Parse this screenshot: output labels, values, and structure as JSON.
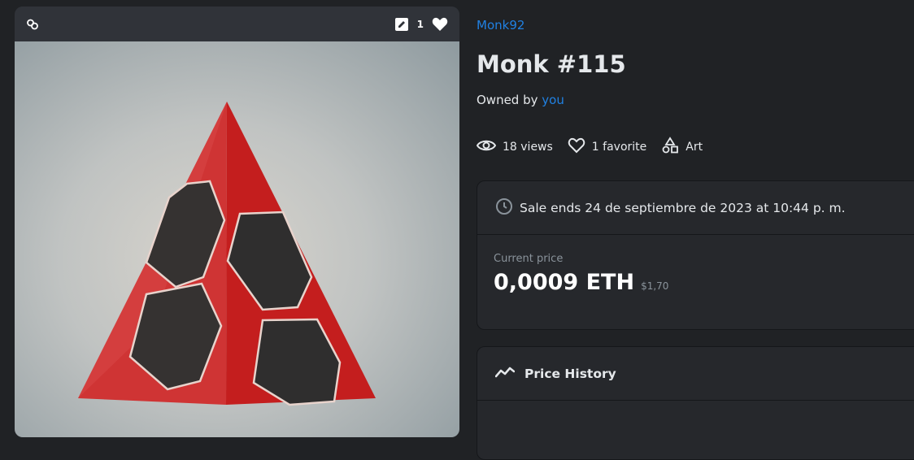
{
  "card": {
    "favorite_count": "1",
    "icons": {
      "link": "link-icon",
      "edit": "edit-icon",
      "heart": "heart-icon"
    }
  },
  "item": {
    "collection": "Monk92",
    "name": "Monk #115",
    "owned_prefix": "Owned by",
    "owner": "you"
  },
  "stats": {
    "views": "18 views",
    "favorites": "1 favorite",
    "category": "Art"
  },
  "sale": {
    "ends_text": "Sale ends 24 de septiembre de 2023 at 10:44 p. m.",
    "current_price_label": "Current price",
    "price_eth": "0,0009 ETH",
    "price_usd": "$1,70"
  },
  "price_history": {
    "title": "Price History"
  },
  "colors": {
    "accent": "#2081e2",
    "background": "#202225",
    "panel": "#26282c",
    "pyramid_red": "#d62a2a",
    "hex_dark": "#333130"
  }
}
